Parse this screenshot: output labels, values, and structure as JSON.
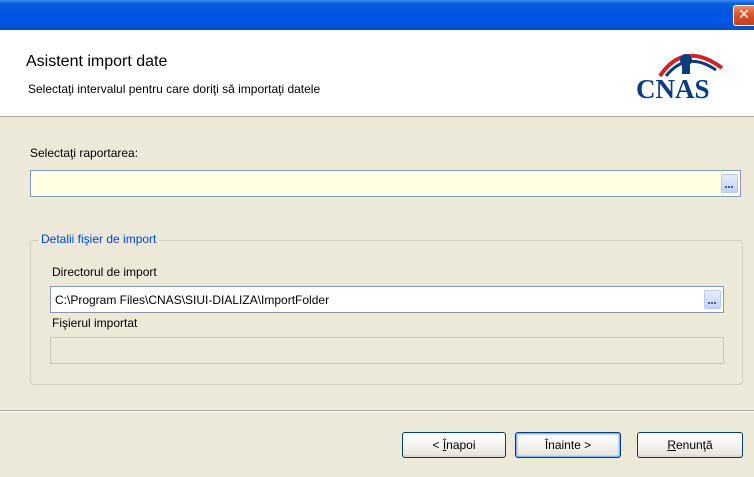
{
  "window": {
    "close_glyph": "✕"
  },
  "header": {
    "title": "Asistent import date",
    "subtitle": "Selectaţi intervalul pentru care doriţi să importaţi datele",
    "logo_text": "CNAS",
    "logo_colors": {
      "text": "#0b3a7e",
      "arc": "#c8262c"
    }
  },
  "reporting": {
    "label": "Selectaţi raportarea:",
    "value": ""
  },
  "import_group": {
    "legend": "Detalii fişier de import",
    "directory": {
      "label": "Directorul de import",
      "value": "C:\\Program Files\\CNAS\\SIUI-DIALIZA\\ImportFolder"
    },
    "imported_file": {
      "label": "Fişierul importat",
      "value": ""
    }
  },
  "buttons": {
    "back": {
      "mnemonic": "Î",
      "rest": "napoi",
      "prefix": "< "
    },
    "next": {
      "text": "Înainte >",
      "mnemonic": ">"
    },
    "cancel": {
      "mnemonic": "R",
      "rest": "enunţă"
    }
  }
}
